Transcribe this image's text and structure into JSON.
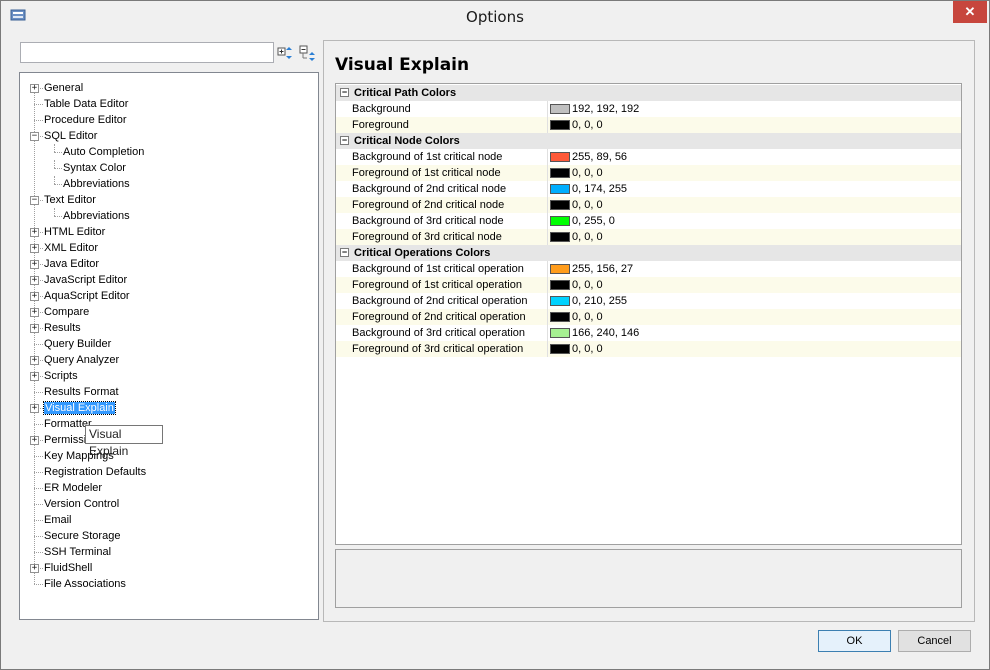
{
  "window": {
    "title": "Options",
    "close_label": "✕"
  },
  "search": {
    "value": "",
    "placeholder": ""
  },
  "tree": [
    {
      "label": "General",
      "expander": "+"
    },
    {
      "label": "Table Data Editor",
      "expander": ""
    },
    {
      "label": "Procedure Editor",
      "expander": ""
    },
    {
      "label": "SQL Editor",
      "expander": "−"
    },
    {
      "label": "Auto Completion",
      "expander": "",
      "child": true
    },
    {
      "label": "Syntax Color",
      "expander": "",
      "child": true
    },
    {
      "label": "Abbreviations",
      "expander": "",
      "child": true
    },
    {
      "label": "Text Editor",
      "expander": "−"
    },
    {
      "label": "Abbreviations",
      "expander": "",
      "child": true
    },
    {
      "label": "HTML Editor",
      "expander": "+"
    },
    {
      "label": "XML Editor",
      "expander": "+"
    },
    {
      "label": "Java Editor",
      "expander": "+"
    },
    {
      "label": "JavaScript Editor",
      "expander": "+"
    },
    {
      "label": "AquaScript Editor",
      "expander": "+"
    },
    {
      "label": "Compare",
      "expander": "+"
    },
    {
      "label": "Results",
      "expander": "+"
    },
    {
      "label": "Query Builder",
      "expander": ""
    },
    {
      "label": "Query Analyzer",
      "expander": "+"
    },
    {
      "label": "Scripts",
      "expander": "+"
    },
    {
      "label": "Results Format",
      "expander": ""
    },
    {
      "label": "Visual Explain",
      "expander": "+",
      "selected": true
    },
    {
      "label": "Formatter",
      "expander": ""
    },
    {
      "label": "Permissions",
      "expander": "+"
    },
    {
      "label": "Key Mappings",
      "expander": ""
    },
    {
      "label": "Registration Defaults",
      "expander": ""
    },
    {
      "label": "ER Modeler",
      "expander": ""
    },
    {
      "label": "Version Control",
      "expander": ""
    },
    {
      "label": "Email",
      "expander": ""
    },
    {
      "label": "Secure Storage",
      "expander": ""
    },
    {
      "label": "SSH Terminal",
      "expander": ""
    },
    {
      "label": "FluidShell",
      "expander": "+"
    },
    {
      "label": "File Associations",
      "expander": ""
    }
  ],
  "tooltip": "Visual Explain",
  "panel": {
    "heading": "Visual Explain"
  },
  "sections": [
    {
      "title": "Critical Path Colors",
      "toggle": "−",
      "rows": [
        {
          "name": "Background",
          "value": "192, 192, 192",
          "color": "#c0c0c0"
        },
        {
          "name": "Foreground",
          "value": "0, 0, 0",
          "color": "#000000"
        }
      ]
    },
    {
      "title": "Critical Node Colors",
      "toggle": "−",
      "rows": [
        {
          "name": "Background of 1st critical node",
          "value": "255, 89, 56",
          "color": "#ff5938"
        },
        {
          "name": "Foreground of 1st critical node",
          "value": "0, 0, 0",
          "color": "#000000"
        },
        {
          "name": "Background of 2nd critical node",
          "value": "0, 174, 255",
          "color": "#00aeff"
        },
        {
          "name": "Foreground of 2nd critical node",
          "value": "0, 0, 0",
          "color": "#000000"
        },
        {
          "name": "Background of 3rd critical node",
          "value": "0, 255, 0",
          "color": "#00ff00"
        },
        {
          "name": "Foreground of 3rd critical node",
          "value": "0, 0, 0",
          "color": "#000000"
        }
      ]
    },
    {
      "title": "Critical Operations Colors",
      "toggle": "−",
      "rows": [
        {
          "name": "Background of 1st critical operation",
          "value": "255, 156, 27",
          "color": "#ff9c1b"
        },
        {
          "name": "Foreground of 1st critical operation",
          "value": "0, 0, 0",
          "color": "#000000"
        },
        {
          "name": "Background of 2nd critical operation",
          "value": "0, 210, 255",
          "color": "#00d2ff"
        },
        {
          "name": "Foreground of 2nd critical operation",
          "value": "0, 0, 0",
          "color": "#000000"
        },
        {
          "name": "Background of 3rd critical operation",
          "value": "166, 240, 146",
          "color": "#a6f092"
        },
        {
          "name": "Foreground of 3rd critical operation",
          "value": "0, 0, 0",
          "color": "#000000"
        }
      ]
    }
  ],
  "buttons": {
    "ok": "OK",
    "cancel": "Cancel"
  }
}
